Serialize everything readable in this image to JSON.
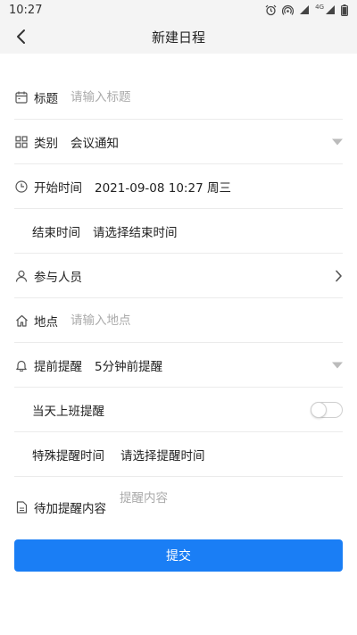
{
  "status_bar": {
    "time": "10:27",
    "network": "4G"
  },
  "header": {
    "title": "新建日程"
  },
  "form": {
    "title": {
      "label": "标题",
      "placeholder": "请输入标题"
    },
    "category": {
      "label": "类别",
      "value": "会议通知"
    },
    "start_time": {
      "label": "开始时间",
      "value": "2021-09-08 10:27 周三"
    },
    "end_time": {
      "label": "结束时间",
      "placeholder": "请选择结束时间"
    },
    "participants": {
      "label": "参与人员"
    },
    "location": {
      "label": "地点",
      "placeholder": "请输入地点"
    },
    "reminder": {
      "label": "提前提醒",
      "value": "5分钟前提醒"
    },
    "workday_reminder": {
      "label": "当天上班提醒",
      "enabled": false
    },
    "special_time": {
      "label": "特殊提醒时间",
      "placeholder": "请选择提醒时间"
    },
    "reminder_content": {
      "label": "待加提醒内容",
      "placeholder": "提醒内容"
    }
  },
  "submit_label": "提交",
  "colors": {
    "accent": "#1a7ef5",
    "placeholder": "#aaaaaa",
    "divider": "#ebebeb"
  }
}
